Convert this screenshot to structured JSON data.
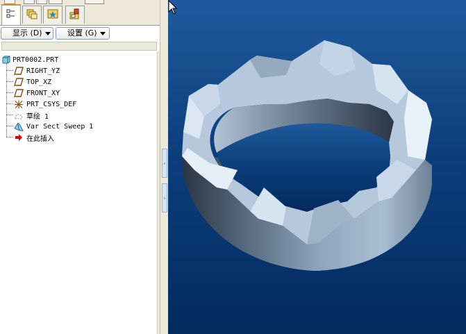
{
  "left_panel": {
    "tabs": [
      {
        "icon": "model-tree-icon",
        "active": true
      },
      {
        "icon": "folder-browser-icon",
        "active": false
      },
      {
        "icon": "favorites-icon",
        "active": false
      },
      {
        "icon": "connections-icon",
        "active": false
      }
    ],
    "menus": {
      "show_label": "显示 (D)",
      "settings_label": "设置 (G)"
    },
    "tree": {
      "root": {
        "label": "PRT0002.PRT",
        "icon": "part-icon"
      },
      "items": [
        {
          "label": "RIGHT_YZ",
          "icon": "datum-plane-icon"
        },
        {
          "label": "TOP_XZ",
          "icon": "datum-plane-icon"
        },
        {
          "label": "FRONT_XY",
          "icon": "datum-plane-icon"
        },
        {
          "label": "PRT_CSYS_DEF",
          "icon": "coordinate-system-icon"
        },
        {
          "label": "草绘 1",
          "icon": "sketch-icon"
        },
        {
          "label": "Var Sect Sweep 1",
          "icon": "sweep-feature-icon"
        },
        {
          "label": "在此插入",
          "icon": "insert-here-arrow-icon"
        }
      ]
    }
  },
  "viewport": {
    "background_top": "#1f5a9c",
    "background_bottom": "#022b5e",
    "model": "wavy-ring-solid"
  },
  "colors": {
    "tab_accent": "#e68b2c",
    "insert_arrow": "#e00000",
    "part_icon": "#7fd3e8"
  }
}
